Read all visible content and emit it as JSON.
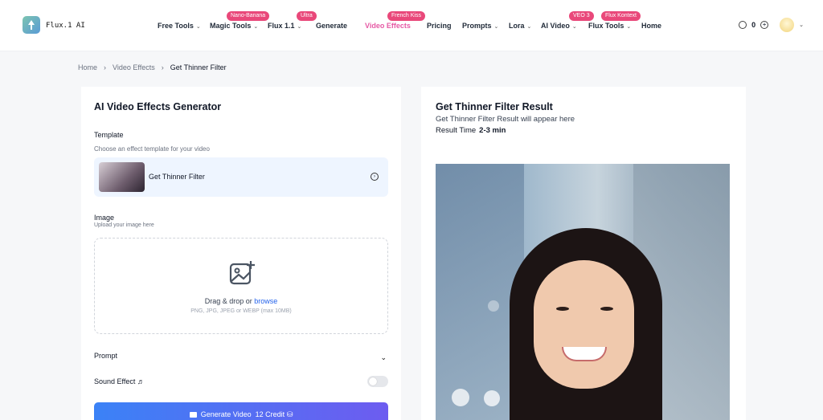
{
  "header": {
    "brand": "Flux.1 AI",
    "nav": [
      {
        "label": "Free Tools",
        "chevron": true,
        "active": false
      },
      {
        "label": "Magic Tools",
        "chevron": true,
        "active": false,
        "badge": "Nano-Banana",
        "badge_color": "#e9487a"
      },
      {
        "label": "Flux 1.1",
        "chevron": true,
        "active": false,
        "badge": "Ultra",
        "badge_color": "#e9487a"
      },
      {
        "label": "Generate",
        "chevron": false,
        "active": false
      },
      {
        "label": "Video Effects",
        "chevron": false,
        "active": true,
        "badge": "French Kiss",
        "badge_color": "#e9487a"
      },
      {
        "label": "Pricing",
        "chevron": false,
        "active": false
      },
      {
        "label": "Prompts",
        "chevron": true,
        "active": false
      },
      {
        "label": "Lora",
        "chevron": true,
        "active": false
      },
      {
        "label": "AI Video",
        "chevron": true,
        "active": false,
        "badge": "VEO 3",
        "badge_color": "#e9487a"
      },
      {
        "label": "Flux Tools",
        "chevron": true,
        "active": false,
        "badge": "Flux Kontext",
        "badge_color": "#e9487a"
      },
      {
        "label": "Home",
        "chevron": false,
        "active": false
      }
    ],
    "credits": "0"
  },
  "breadcrumb": {
    "items": [
      "Home",
      "Video Effects",
      "Get Thinner Filter"
    ]
  },
  "generator": {
    "title": "AI Video Effects Generator",
    "template_label": "Template",
    "template_sub": "Choose an effect template for your video",
    "template_name": "Get Thinner Filter",
    "image_label": "Image",
    "image_sub": "Upload your image here",
    "drop_text": "Drag & drop or ",
    "browse_text": "browse",
    "drop_hint": "PNG, JPG, JPEG or WEBP (max 10MB)",
    "prompt_label": "Prompt",
    "sound_label": "Sound Effect",
    "sound_enabled": false,
    "generate_label": "Generate Video",
    "credit_label": "12 Credit"
  },
  "result": {
    "title": "Get Thinner Filter Result",
    "subtitle": "Get Thinner Filter Result will appear here",
    "time_label": "Result Time",
    "time_value": "2-3 min"
  },
  "colors": {
    "accent": "#e65aa5",
    "button_start": "#3b82f6",
    "button_end": "#6d5cf0",
    "template_bg": "#eef5ff"
  }
}
